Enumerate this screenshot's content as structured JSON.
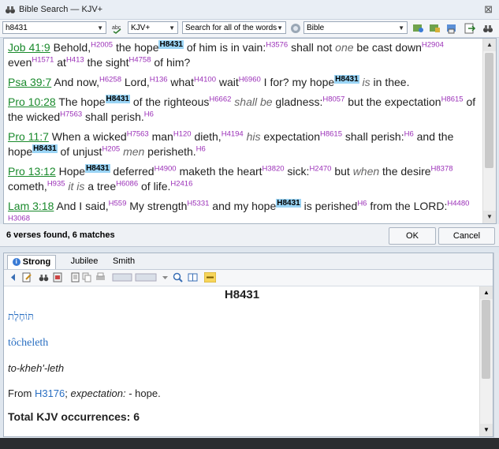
{
  "window": {
    "title": "Bible Search — KJV+"
  },
  "toolbar": {
    "search_value": "h8431",
    "version": "KJV+",
    "search_mode": "Search for all of the words",
    "scope": "Bible"
  },
  "results": {
    "verses": [
      {
        "ref": "Job 41:9",
        "segments": [
          {
            "t": "text",
            "v": " Behold,"
          },
          {
            "t": "sn",
            "v": "H2005"
          },
          {
            "t": "text",
            "v": " the hope"
          },
          {
            "t": "hl",
            "v": "H8431"
          },
          {
            "t": "text",
            "v": " of him is in vain:"
          },
          {
            "t": "sn",
            "v": "H3576"
          },
          {
            "t": "text",
            "v": " shall not "
          },
          {
            "t": "it",
            "v": "one"
          },
          {
            "t": "text",
            "v": " be cast down"
          },
          {
            "t": "sn",
            "v": "H2904"
          },
          {
            "t": "text",
            "v": " even"
          },
          {
            "t": "sn",
            "v": "H1571"
          },
          {
            "t": "text",
            "v": " at"
          },
          {
            "t": "sn",
            "v": "H413"
          },
          {
            "t": "text",
            "v": " the sight"
          },
          {
            "t": "sn",
            "v": "H4758"
          },
          {
            "t": "text",
            "v": " of him?"
          }
        ]
      },
      {
        "ref": "Psa 39:7",
        "segments": [
          {
            "t": "text",
            "v": " And now,"
          },
          {
            "t": "sn",
            "v": "H6258"
          },
          {
            "t": "text",
            "v": " Lord,"
          },
          {
            "t": "sn",
            "v": "H136"
          },
          {
            "t": "text",
            "v": " what"
          },
          {
            "t": "sn",
            "v": "H4100"
          },
          {
            "t": "text",
            "v": " wait"
          },
          {
            "t": "sn",
            "v": "H6960"
          },
          {
            "t": "text",
            "v": " I for? my hope"
          },
          {
            "t": "hl",
            "v": "H8431"
          },
          {
            "t": "text",
            "v": " "
          },
          {
            "t": "it",
            "v": "is"
          },
          {
            "t": "text",
            "v": " in thee."
          }
        ]
      },
      {
        "ref": "Pro 10:28",
        "segments": [
          {
            "t": "text",
            "v": " The hope"
          },
          {
            "t": "hl",
            "v": "H8431"
          },
          {
            "t": "text",
            "v": " of the righteous"
          },
          {
            "t": "sn",
            "v": "H6662"
          },
          {
            "t": "text",
            "v": " "
          },
          {
            "t": "it",
            "v": "shall be"
          },
          {
            "t": "text",
            "v": " gladness:"
          },
          {
            "t": "sn",
            "v": "H8057"
          },
          {
            "t": "text",
            "v": " but the expectation"
          },
          {
            "t": "sn",
            "v": "H8615"
          },
          {
            "t": "text",
            "v": " of the wicked"
          },
          {
            "t": "sn",
            "v": "H7563"
          },
          {
            "t": "text",
            "v": " shall perish."
          },
          {
            "t": "sn",
            "v": "H6"
          }
        ]
      },
      {
        "ref": "Pro 11:7",
        "segments": [
          {
            "t": "text",
            "v": " When a wicked"
          },
          {
            "t": "sn",
            "v": "H7563"
          },
          {
            "t": "text",
            "v": " man"
          },
          {
            "t": "sn",
            "v": "H120"
          },
          {
            "t": "text",
            "v": " dieth,"
          },
          {
            "t": "sn",
            "v": "H4194"
          },
          {
            "t": "text",
            "v": " "
          },
          {
            "t": "it",
            "v": "his"
          },
          {
            "t": "text",
            "v": " expectation"
          },
          {
            "t": "sn",
            "v": "H8615"
          },
          {
            "t": "text",
            "v": " shall perish:"
          },
          {
            "t": "sn",
            "v": "H6"
          },
          {
            "t": "text",
            "v": " and the hope"
          },
          {
            "t": "hl",
            "v": "H8431"
          },
          {
            "t": "text",
            "v": " of unjust"
          },
          {
            "t": "sn",
            "v": "H205"
          },
          {
            "t": "text",
            "v": " "
          },
          {
            "t": "it",
            "v": "men"
          },
          {
            "t": "text",
            "v": " perisheth."
          },
          {
            "t": "sn",
            "v": "H6"
          }
        ]
      },
      {
        "ref": "Pro 13:12",
        "segments": [
          {
            "t": "text",
            "v": " Hope"
          },
          {
            "t": "hl",
            "v": "H8431"
          },
          {
            "t": "text",
            "v": " deferred"
          },
          {
            "t": "sn",
            "v": "H4900"
          },
          {
            "t": "text",
            "v": " maketh the heart"
          },
          {
            "t": "sn",
            "v": "H3820"
          },
          {
            "t": "text",
            "v": " sick:"
          },
          {
            "t": "sn",
            "v": "H2470"
          },
          {
            "t": "text",
            "v": " but "
          },
          {
            "t": "it",
            "v": "when"
          },
          {
            "t": "text",
            "v": " the desire"
          },
          {
            "t": "sn",
            "v": "H8378"
          },
          {
            "t": "text",
            "v": " cometh,"
          },
          {
            "t": "sn",
            "v": "H935"
          },
          {
            "t": "text",
            "v": " "
          },
          {
            "t": "it",
            "v": "it is"
          },
          {
            "t": "text",
            "v": " a tree"
          },
          {
            "t": "sn",
            "v": "H6086"
          },
          {
            "t": "text",
            "v": " of life."
          },
          {
            "t": "sn",
            "v": "H2416"
          }
        ]
      },
      {
        "ref": "Lam 3:18",
        "segments": [
          {
            "t": "text",
            "v": " And I said,"
          },
          {
            "t": "sn",
            "v": "H559"
          },
          {
            "t": "text",
            "v": " My strength"
          },
          {
            "t": "sn",
            "v": "H5331"
          },
          {
            "t": "text",
            "v": " and my hope"
          },
          {
            "t": "hl",
            "v": "H8431"
          },
          {
            "t": "text",
            "v": " is perished"
          },
          {
            "t": "sn",
            "v": "H6"
          },
          {
            "t": "text",
            "v": " from the LORD:"
          },
          {
            "t": "sn",
            "v": "H4480 H3068"
          }
        ]
      }
    ],
    "found_text": "6 verses found, 6 matches"
  },
  "statusbar": {
    "text": "6 verses found, 6 matches",
    "ok_label": "OK",
    "cancel_label": "Cancel"
  },
  "lower": {
    "tabs": [
      "Strong",
      "Jubilee",
      "Smith"
    ],
    "entry": {
      "title": "H8431",
      "hebrew": "תּוֹחֶלֶת",
      "translit": "tôcheleth",
      "pronunciation": "to-kheh'-leth",
      "from_label": "From ",
      "from_ref": "H3176",
      "definition_pre": "; ",
      "definition": "expectation:",
      "definition_post": " - hope.",
      "total": "Total KJV occurrences: 6"
    }
  },
  "colors": {
    "ref_green": "#1a8a2c",
    "strong_purple": "#9b30b8",
    "highlight": "#9ad4f5",
    "link_blue": "#2a6fc2"
  }
}
